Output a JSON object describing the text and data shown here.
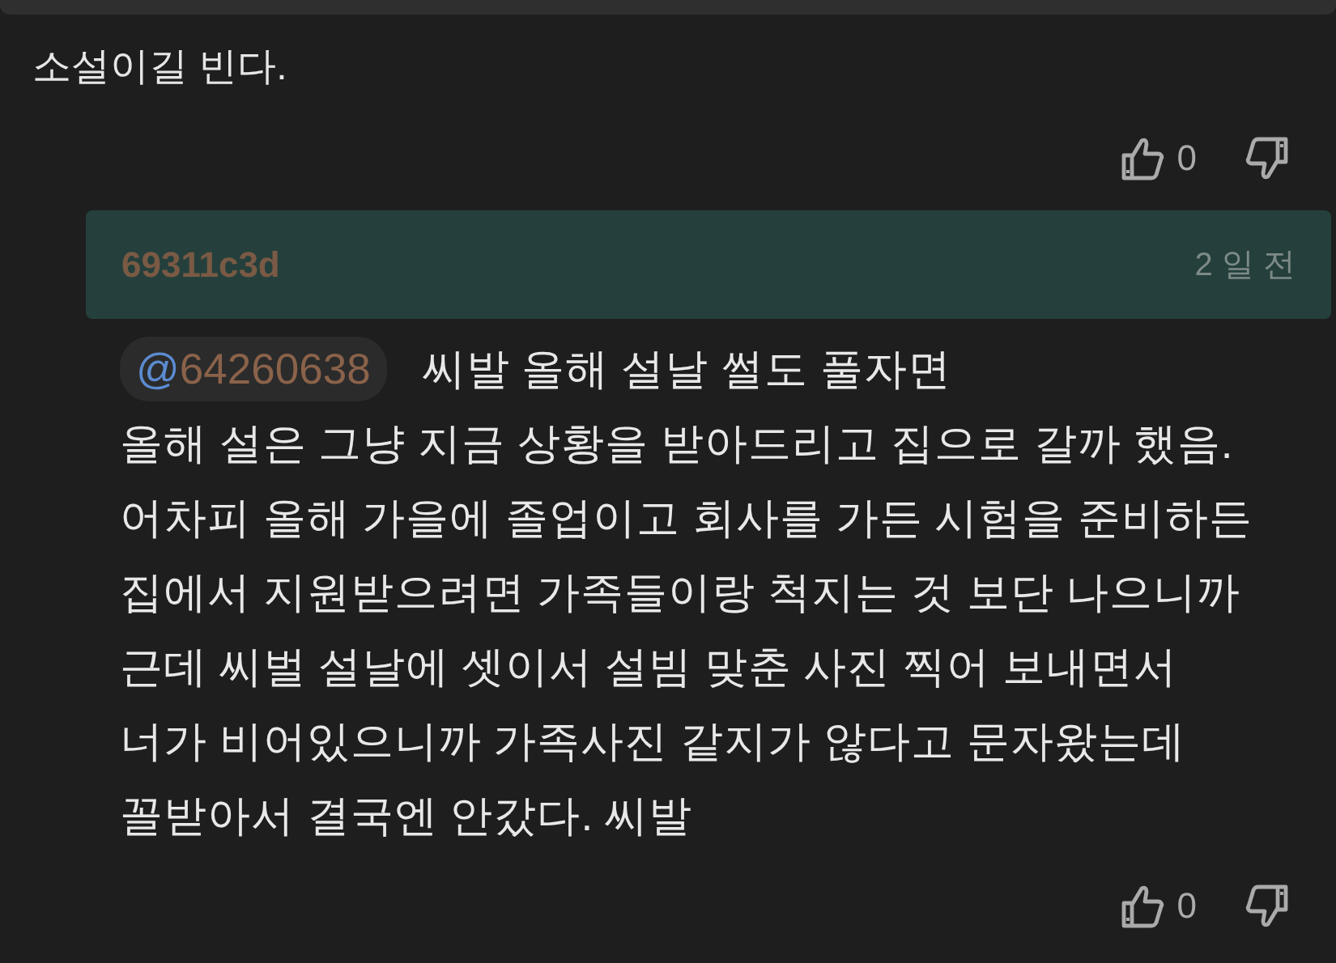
{
  "comment": {
    "text": "소설이길 빈다.",
    "likes": "0"
  },
  "reply": {
    "user": "69311c3d",
    "time": "2 일 전",
    "mention": {
      "at": "@",
      "user": "64260638"
    },
    "lines": [
      "씨발 올해 설날 썰도 풀자면",
      "올해 설은 그냥 지금 상황을 받아드리고 집으로 갈까 했음.",
      "어차피 올해 가을에 졸업이고 회사를 가든 시험을 준비하든",
      "집에서 지원받으려면 가족들이랑 척지는 것 보단 나으니까",
      "근데 씨벌 설날에 셋이서 설빔 맞춘 사진 찍어 보내면서",
      "너가 비어있으니까 가족사진 같지가 않다고 문자왔는데",
      "꼴받아서 결국엔 안갔다. 씨발"
    ],
    "likes": "0"
  }
}
